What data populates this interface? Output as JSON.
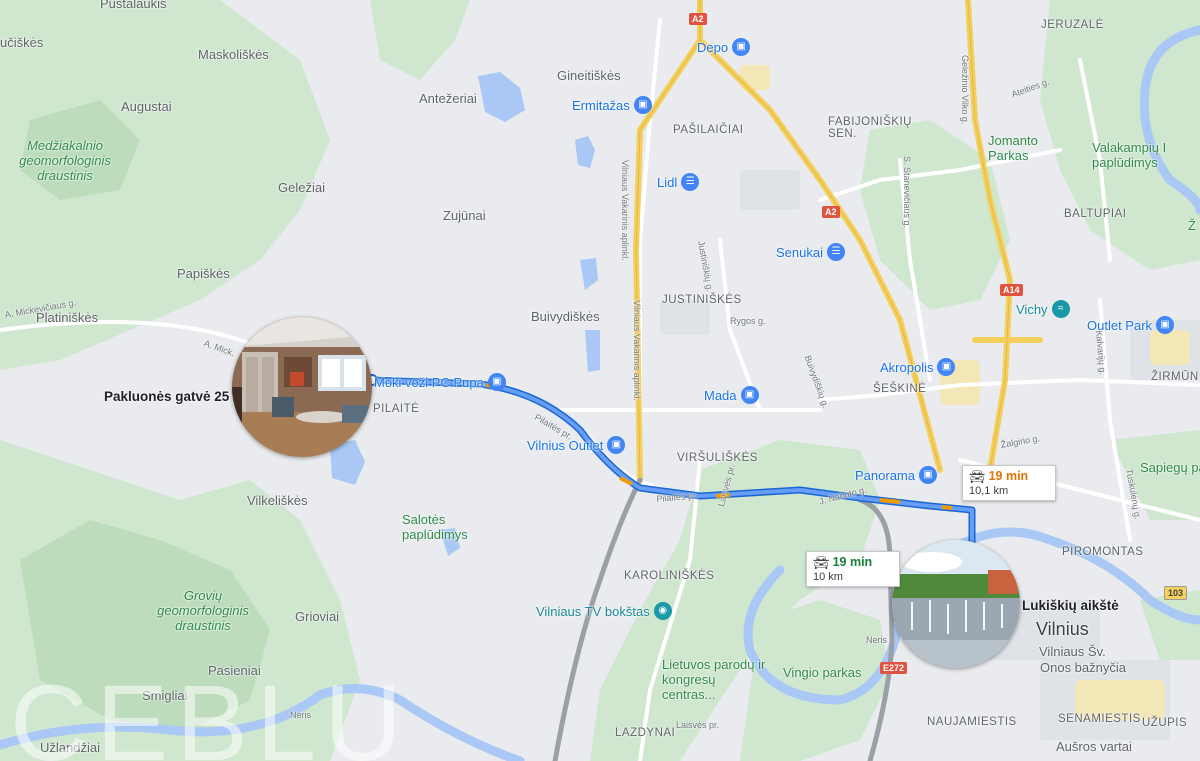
{
  "map": {
    "address_label": "Pakluonės gatvė 25",
    "destination_label": "Lukiškių aikštė",
    "city_label": "Vilnius",
    "watermark": "CEBLU",
    "route_cards": [
      {
        "time": "19 min",
        "distance": "10,1 km",
        "icon": "car-icon",
        "time_color": "#e37400"
      },
      {
        "time": "19 min",
        "distance": "10 km",
        "icon": "car-icon",
        "time_color": "#188038"
      }
    ],
    "places": [
      {
        "text": "Pustalaukis",
        "cls": ""
      },
      {
        "text": "učiškės",
        "cls": ""
      },
      {
        "text": "Maskoliškės",
        "cls": ""
      },
      {
        "text": "Augustai",
        "cls": ""
      },
      {
        "text": "Medžiakalnio geomorfologinis draustinis",
        "cls": "park"
      },
      {
        "text": "Antežeriai",
        "cls": ""
      },
      {
        "text": "Gineitiškės",
        "cls": ""
      },
      {
        "text": "Geležiai",
        "cls": ""
      },
      {
        "text": "Zujūnai",
        "cls": ""
      },
      {
        "text": "Papiškės",
        "cls": ""
      },
      {
        "text": "Platiniškės",
        "cls": ""
      },
      {
        "text": "Buivydiškės",
        "cls": ""
      },
      {
        "text": "PILAITĖ",
        "cls": "district"
      },
      {
        "text": "Vilkeliškės",
        "cls": ""
      },
      {
        "text": "Salotės paplūdimys",
        "cls": "greenpoi"
      },
      {
        "text": "Grovių geomorfologinis draustinis",
        "cls": "park"
      },
      {
        "text": "Grioviai",
        "cls": ""
      },
      {
        "text": "Pasieniai",
        "cls": ""
      },
      {
        "text": "Smigliai",
        "cls": ""
      },
      {
        "text": "Užlandžiai",
        "cls": ""
      },
      {
        "text": "PAŠILAIČIAI",
        "cls": "district"
      },
      {
        "text": "FABIJONIŠKIŲ SEN.",
        "cls": "district"
      },
      {
        "text": "JUSTINIŠKĖS",
        "cls": "district"
      },
      {
        "text": "VIRŠULIŠKĖS",
        "cls": "district"
      },
      {
        "text": "KAROLINIŠKĖS",
        "cls": "district"
      },
      {
        "text": "LAZDYNAI",
        "cls": "district"
      },
      {
        "text": "ŠEŠKINĖ",
        "cls": "district"
      },
      {
        "text": "JERUZALĖ",
        "cls": "district"
      },
      {
        "text": "BALTUPIAI",
        "cls": "district"
      },
      {
        "text": "ŽIRMŪN",
        "cls": "district"
      },
      {
        "text": "PIROMONTAS",
        "cls": "district"
      },
      {
        "text": "NAUJAMIESTIS",
        "cls": "district"
      },
      {
        "text": "SENAMIESTIS",
        "cls": "district"
      },
      {
        "text": "UŽUPIS",
        "cls": "district"
      },
      {
        "text": "Jomanto Parkas",
        "cls": "greenpoi"
      },
      {
        "text": "Valakampių I paplūdimys",
        "cls": "greenpoi"
      },
      {
        "text": "Sapiegų pa",
        "cls": "greenpoi"
      },
      {
        "text": "Vingio parkas",
        "cls": "greenpoi"
      },
      {
        "text": "Lietuvos parodų ir kongresų centras...",
        "cls": "greenpoi"
      },
      {
        "text": "Onos bažnyčia",
        "cls": ""
      },
      {
        "text": "Vilniaus Šv.",
        "cls": ""
      },
      {
        "text": "Aušros vartai",
        "cls": ""
      },
      {
        "text": "Ž",
        "cls": "greenpoi"
      },
      {
        "text": "Neris",
        "cls": "street"
      },
      {
        "text": "Neris",
        "cls": "street"
      }
    ],
    "pois": [
      {
        "text": "Depo",
        "icon": "shopping-bag-icon",
        "color": "blue"
      },
      {
        "text": "Ermitažas",
        "icon": "shopping-bag-icon",
        "color": "blue"
      },
      {
        "text": "Lidl",
        "icon": "shopping-cart-icon",
        "color": "blue"
      },
      {
        "text": "Senukai",
        "icon": "shopping-cart-icon",
        "color": "blue"
      },
      {
        "text": "Moki veži PC Pupa",
        "icon": "shopping-bag-icon",
        "color": "blue"
      },
      {
        "text": "Vilnius Outlet",
        "icon": "shopping-bag-icon",
        "color": "blue"
      },
      {
        "text": "Mada",
        "icon": "shopping-bag-icon",
        "color": "blue"
      },
      {
        "text": "Akropolis",
        "icon": "shopping-bag-icon",
        "color": "blue"
      },
      {
        "text": "Panorama",
        "icon": "shopping-bag-icon",
        "color": "blue"
      },
      {
        "text": "Vichy",
        "icon": "water-park-icon",
        "color": "teal"
      },
      {
        "text": "Outlet Park",
        "icon": "shopping-bag-icon",
        "color": "blue"
      },
      {
        "text": "Vilniaus TV bokštas",
        "icon": "camera-icon",
        "color": "teal"
      }
    ],
    "roads": [
      {
        "text": "Vilniaus Vakarinis aplinkl."
      },
      {
        "text": "Vilniaus Vakarinis aplinkl."
      },
      {
        "text": "Geležinio Vilko g."
      },
      {
        "text": "A. Mickevičiaus g."
      },
      {
        "text": "A. Mick."
      },
      {
        "text": "Justiniškių g."
      },
      {
        "text": "Rygos g."
      },
      {
        "text": "Buivydiškių g."
      },
      {
        "text": "Pilaitės pr."
      },
      {
        "text": "Pilaitės pr."
      },
      {
        "text": "Laisvės pr."
      },
      {
        "text": "J. Nabuto g."
      },
      {
        "text": "Ateities g."
      },
      {
        "text": "S. Stanevičiaus g."
      },
      {
        "text": "Kalvarijų g."
      },
      {
        "text": "Žalgirio g."
      },
      {
        "text": "Tuskulėnų g."
      },
      {
        "text": "Laisvės pr."
      }
    ],
    "shields": [
      {
        "text": "A2"
      },
      {
        "text": "A2"
      },
      {
        "text": "A14"
      },
      {
        "text": "E272"
      },
      {
        "text": "103"
      }
    ]
  }
}
